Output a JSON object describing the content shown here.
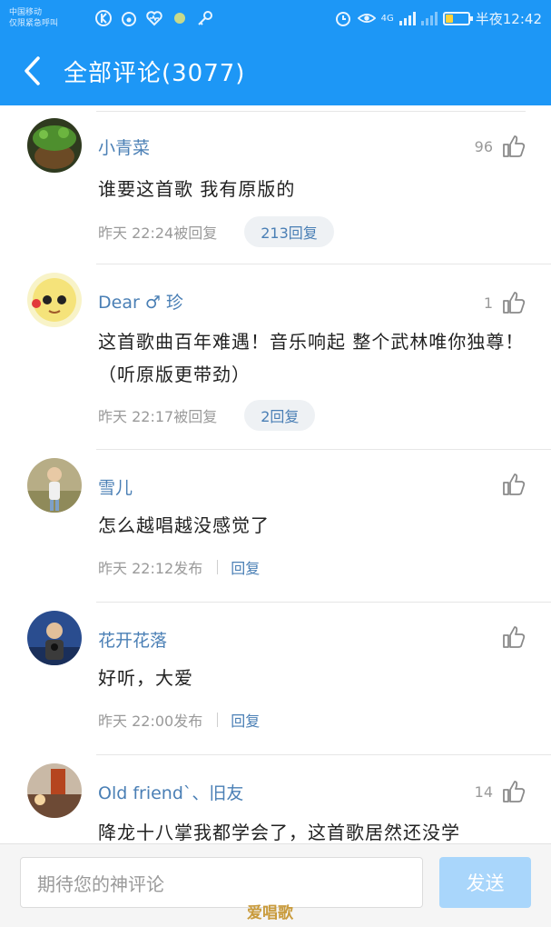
{
  "status_bar": {
    "carrier_line1": "中国移动",
    "carrier_line2": "仅限紧急呼叫",
    "network": "4G",
    "time": "半夜12:42"
  },
  "header": {
    "title": "全部评论(3077)"
  },
  "comments": [
    {
      "name": "小青菜",
      "likes": "96",
      "text": "谁要这首歌 我有原版的",
      "time": "昨天 22:24被回复",
      "reply": "213回复"
    },
    {
      "name": "Dear ♂ 珍",
      "likes": "1",
      "text": "这首歌曲百年难遇！音乐响起 整个武林唯你独尊！（听原版更带劲）",
      "time": "昨天 22:17被回复",
      "reply": "2回复"
    },
    {
      "name": "雪儿",
      "likes": "",
      "text": "怎么越唱越没感觉了",
      "time": "昨天 22:12发布",
      "reply": "回复"
    },
    {
      "name": "花开花落",
      "likes": "",
      "text": "好听，大爱",
      "time": "昨天 22:00发布",
      "reply": "回复"
    },
    {
      "name": "Old friend`、旧友",
      "likes": "14",
      "text": "降龙十八掌我都学会了，这首歌居然还没学",
      "time": "",
      "reply": ""
    }
  ],
  "input_bar": {
    "placeholder": "期待您的神评论",
    "send_label": "发送"
  },
  "watermark": "爱唱歌",
  "colors": {
    "brand_blue": "#1d97f6",
    "name_blue": "#4a7fb5",
    "send_disabled": "#a9d6fb"
  }
}
